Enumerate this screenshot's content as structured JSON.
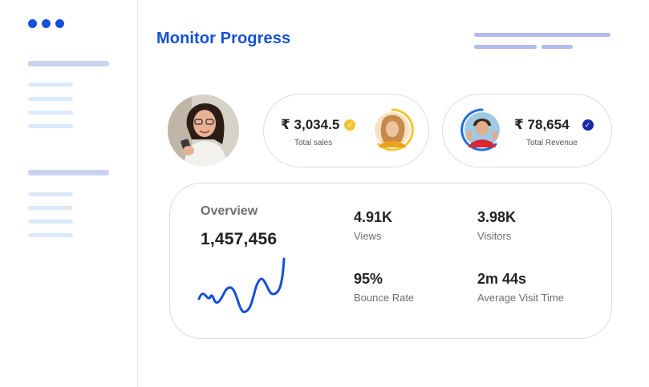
{
  "app": {
    "title": "Monitor Progress",
    "accent": "#1550d8"
  },
  "sidebar": {
    "section_count": 2,
    "items_per_section": 4
  },
  "cards": [
    {
      "value": "₹ 3,034.5",
      "label": "Total sales",
      "check_color": "#f4c430",
      "ring_color": "#f4c430"
    },
    {
      "value": "₹ 78,654",
      "label": "Total Revenue",
      "check_color": "#1a2aa8",
      "ring_color": "#1f6fdc"
    }
  ],
  "overview": {
    "title": "Overview",
    "total": "1,457,456",
    "metrics": [
      {
        "value": "4.91K",
        "label": "Views"
      },
      {
        "value": "3.98K",
        "label": "Visitors"
      },
      {
        "value": "95%",
        "label": "Bounce Rate"
      },
      {
        "value": "2m 44s",
        "label": "Average Visit Time"
      }
    ]
  }
}
